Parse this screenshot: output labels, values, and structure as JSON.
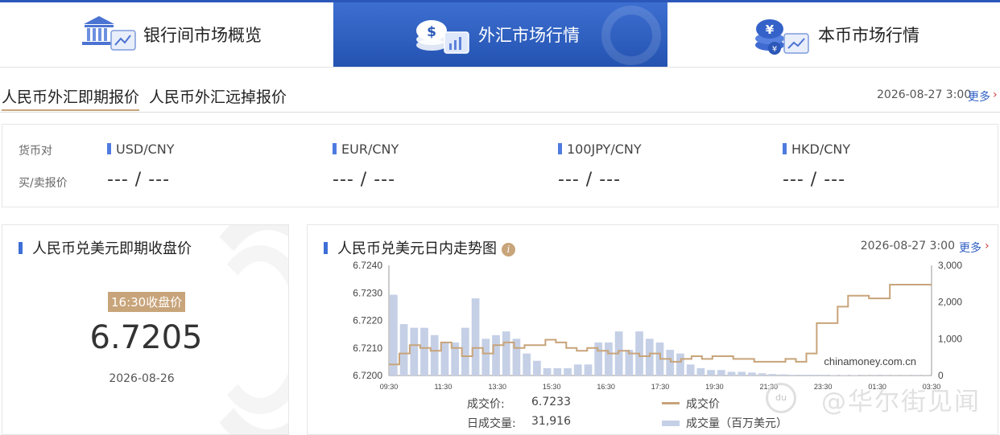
{
  "nav": {
    "items": [
      {
        "label": "银行间市场概览",
        "active": false
      },
      {
        "label": "外汇市场行情",
        "active": true
      },
      {
        "label": "本币市场行情",
        "active": false
      }
    ]
  },
  "subtabs": {
    "items": [
      {
        "label": "人民币外汇即期报价",
        "active": true
      },
      {
        "label": "人民币外汇远掉报价",
        "active": false
      }
    ],
    "datetime": "2026-08-27 3:00",
    "more": "更多"
  },
  "quotes": {
    "pair_label": "货币对",
    "price_label": "买/卖报价",
    "pairs": [
      {
        "name": "USD/CNY",
        "value": "--- / ---"
      },
      {
        "name": "EUR/CNY",
        "value": "--- / ---"
      },
      {
        "name": "100JPY/CNY",
        "value": "--- / ---"
      },
      {
        "name": "HKD/CNY",
        "value": "--- / ---"
      }
    ]
  },
  "closing": {
    "title": "人民币兑美元即期收盘价",
    "badge": "16:30收盘价",
    "value": "6.7205",
    "date": "2026-08-26"
  },
  "intraday": {
    "title": "人民币兑美元日内走势图",
    "datetime": "2026-08-27 3:00",
    "more": "更多",
    "watermark_text": "chinamoney.com.cn",
    "stats": [
      {
        "label": "成交价:",
        "value": "6.7233"
      },
      {
        "label": "日成交量:",
        "value": "31,916"
      }
    ],
    "legend": [
      {
        "label": "成交价",
        "kind": "line",
        "color": "#c8a47a"
      },
      {
        "label": "成交量（百万美元）",
        "kind": "bar",
        "color": "#c5d0e6"
      }
    ]
  },
  "chart_data": {
    "type": "line",
    "title": "人民币兑美元日内走势图",
    "x_ticks": [
      "09:30",
      "11:30",
      "13:30",
      "15:30",
      "16:30",
      "17:30",
      "19:30",
      "21:30",
      "23:30",
      "01:30",
      "03:30"
    ],
    "y_left_ticks": [
      "6.7240",
      "6.7230",
      "6.7220",
      "6.7210",
      "6.7200"
    ],
    "y_left_range": [
      6.72,
      6.724
    ],
    "y_right_ticks": [
      "3,000",
      "2,000",
      "1,000",
      "0"
    ],
    "y_right_range": [
      0,
      3000
    ],
    "series": [
      {
        "name": "成交价",
        "axis": "left",
        "color": "#c8a47a",
        "values": [
          6.7204,
          6.7208,
          6.7211,
          6.721,
          6.7209,
          6.7212,
          6.721,
          6.7207,
          6.721,
          6.7208,
          6.7211,
          6.7212,
          6.721,
          6.7211,
          6.7211,
          6.7213,
          6.7212,
          6.721,
          6.7209,
          6.721,
          6.7209,
          6.7208,
          6.7209,
          6.7208,
          6.7207,
          6.7208,
          6.7206,
          6.7205,
          6.7206,
          6.7207,
          6.7206,
          6.7207,
          6.7207,
          6.7206,
          6.7206,
          6.7205,
          6.7205,
          6.7205,
          6.7206,
          6.7205,
          6.7208,
          6.7219,
          6.7219,
          6.7225,
          6.7229,
          6.7229,
          6.7228,
          6.7228,
          6.7233,
          6.7233,
          6.7233,
          6.7233,
          6.7233
        ]
      },
      {
        "name": "成交量（百万美元）",
        "axis": "right",
        "kind": "bar",
        "color": "#c5d0e6",
        "values": [
          2200,
          1400,
          1300,
          1300,
          1100,
          900,
          900,
          1300,
          2100,
          1000,
          1100,
          1200,
          1000,
          600,
          400,
          200,
          200,
          200,
          300,
          300,
          900,
          900,
          1200,
          700,
          1200,
          1000,
          900,
          700,
          600,
          300,
          200,
          150,
          150,
          100,
          100,
          80,
          60,
          40,
          30,
          20,
          20,
          20,
          20,
          10,
          10,
          10,
          5,
          5,
          5,
          5,
          5,
          5,
          5
        ]
      }
    ]
  }
}
